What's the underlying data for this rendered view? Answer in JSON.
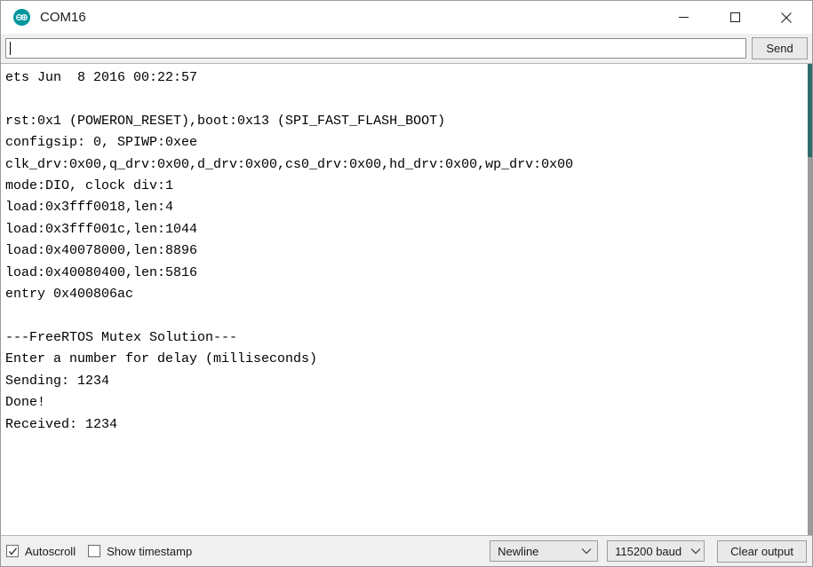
{
  "window": {
    "title": "COM16",
    "logo_icon": "arduino-logo-icon",
    "logo_color": "#00979c",
    "minimize_label": "—",
    "maximize_label": "□",
    "close_label": "✕"
  },
  "send_row": {
    "input_value": "",
    "input_placeholder": "",
    "send_label": "Send"
  },
  "console": {
    "lines": [
      "ets Jun  8 2016 00:22:57",
      "",
      "rst:0x1 (POWERON_RESET),boot:0x13 (SPI_FAST_FLASH_BOOT)",
      "configsip: 0, SPIWP:0xee",
      "clk_drv:0x00,q_drv:0x00,d_drv:0x00,cs0_drv:0x00,hd_drv:0x00,wp_drv:0x00",
      "mode:DIO, clock div:1",
      "load:0x3fff0018,len:4",
      "load:0x3fff001c,len:1044",
      "load:0x40078000,len:8896",
      "load:0x40080400,len:5816",
      "entry 0x400806ac",
      "",
      "---FreeRTOS Mutex Solution---",
      "Enter a number for delay (milliseconds)",
      "Sending: 1234",
      "Done!",
      "Received: 1234"
    ],
    "scrollbar_thumb_color": "#2e6b6b",
    "scrollbar_track_color": "#9a9a9a"
  },
  "status_bar": {
    "autoscroll": {
      "label": "Autoscroll",
      "checked": true
    },
    "show_timestamp": {
      "label": "Show timestamp",
      "checked": false
    },
    "line_ending": {
      "selected": "Newline"
    },
    "baud_rate": {
      "selected": "115200 baud"
    },
    "clear_output_label": "Clear output"
  }
}
